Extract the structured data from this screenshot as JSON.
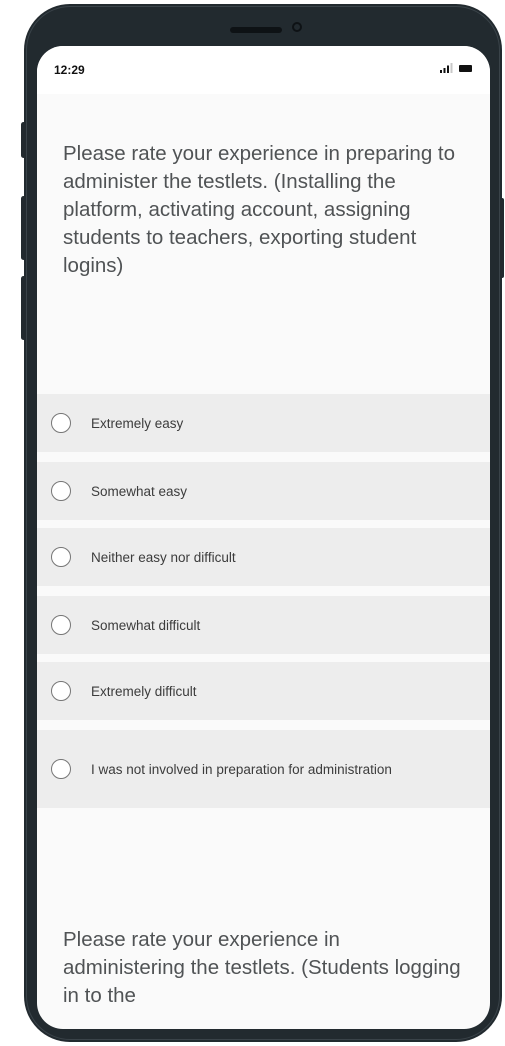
{
  "status_bar": {
    "time": "12:29",
    "signal_icon": "signal-icon",
    "battery_icon": "battery-icon"
  },
  "survey": {
    "question_1": {
      "text": "Please rate your experience in preparing to administer the testlets. (Installing the platform, activating account, assigning students to teachers, exporting student logins)",
      "options": [
        {
          "label": "Extremely easy",
          "selected": false
        },
        {
          "label": "Somewhat easy",
          "selected": false
        },
        {
          "label": "Neither easy nor difficult",
          "selected": false
        },
        {
          "label": "Somewhat difficult",
          "selected": false
        },
        {
          "label": "Extremely difficult",
          "selected": false
        },
        {
          "label": "I was not involved in preparation for administration",
          "selected": false
        }
      ]
    },
    "question_2": {
      "text": "Please rate your experience in administering the testlets. (Students logging in to the"
    }
  },
  "colors": {
    "frame": "#222a2f",
    "screen_background": "#fafafa",
    "option_background": "#ededed",
    "question_text": "#505355",
    "option_text": "#3c3c3c"
  }
}
